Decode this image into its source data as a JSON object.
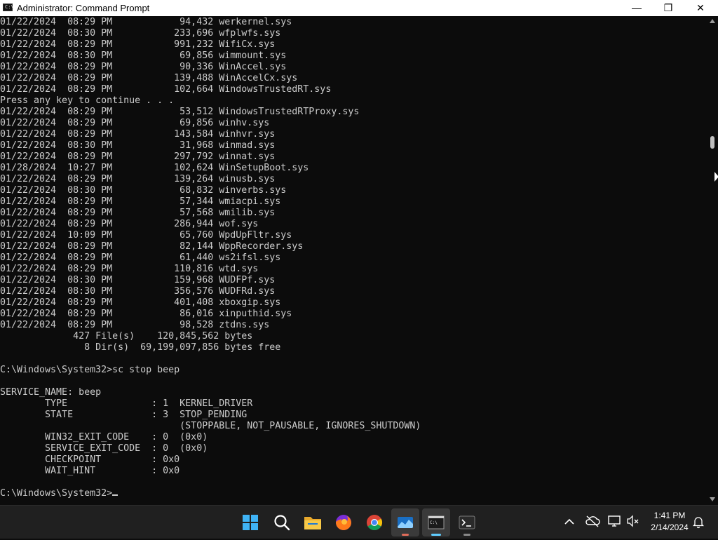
{
  "window": {
    "title": "Administrator: Command Prompt",
    "icon": "cmd-icon",
    "controls": {
      "minimize": "—",
      "maximize": "❐",
      "close": "✕"
    }
  },
  "console": {
    "lines": [
      "01/22/2024  08:29 PM            94,432 werkernel.sys",
      "01/22/2024  08:30 PM           233,696 wfplwfs.sys",
      "01/22/2024  08:29 PM           991,232 WifiCx.sys",
      "01/22/2024  08:30 PM            69,856 wimmount.sys",
      "01/22/2024  08:29 PM            90,336 WinAccel.sys",
      "01/22/2024  08:29 PM           139,488 WinAccelCx.sys",
      "01/22/2024  08:29 PM           102,664 WindowsTrustedRT.sys",
      "Press any key to continue . . .",
      "01/22/2024  08:29 PM            53,512 WindowsTrustedRTProxy.sys",
      "01/22/2024  08:29 PM            69,856 winhv.sys",
      "01/22/2024  08:29 PM           143,584 winhvr.sys",
      "01/22/2024  08:30 PM            31,968 winmad.sys",
      "01/22/2024  08:29 PM           297,792 winnat.sys",
      "01/28/2024  10:27 PM           102,624 WinSetupBoot.sys",
      "01/22/2024  08:29 PM           139,264 winusb.sys",
      "01/22/2024  08:30 PM            68,832 winverbs.sys",
      "01/22/2024  08:29 PM            57,344 wmiacpi.sys",
      "01/22/2024  08:29 PM            57,568 wmilib.sys",
      "01/22/2024  08:29 PM           286,944 wof.sys",
      "01/22/2024  10:09 PM            65,760 WpdUpFltr.sys",
      "01/22/2024  08:29 PM            82,144 WppRecorder.sys",
      "01/22/2024  08:29 PM            61,440 ws2ifsl.sys",
      "01/22/2024  08:29 PM           110,816 wtd.sys",
      "01/22/2024  08:30 PM           159,968 WUDFPf.sys",
      "01/22/2024  08:30 PM           356,576 WUDFRd.sys",
      "01/22/2024  08:29 PM           401,408 xboxgip.sys",
      "01/22/2024  08:29 PM            86,016 xinputhid.sys",
      "01/22/2024  08:29 PM            98,528 ztdns.sys",
      "             427 File(s)    120,845,562 bytes",
      "               8 Dir(s)  69,199,097,856 bytes free",
      "",
      "C:\\Windows\\System32>sc stop beep",
      "",
      "SERVICE_NAME: beep",
      "        TYPE               : 1  KERNEL_DRIVER",
      "        STATE              : 3  STOP_PENDING",
      "                                (STOPPABLE, NOT_PAUSABLE, IGNORES_SHUTDOWN)",
      "        WIN32_EXIT_CODE    : 0  (0x0)",
      "        SERVICE_EXIT_CODE  : 0  (0x0)",
      "        CHECKPOINT         : 0x0",
      "        WAIT_HINT          : 0x0",
      ""
    ],
    "prompt": "C:\\Windows\\System32>",
    "text_color": "#cccccc",
    "background": "#0c0c0c"
  },
  "taskbar": {
    "apps": [
      {
        "name": "start",
        "icon": "windows-logo-icon"
      },
      {
        "name": "search",
        "icon": "search-icon"
      },
      {
        "name": "file-explorer",
        "icon": "folder-icon"
      },
      {
        "name": "firefox",
        "icon": "firefox-icon"
      },
      {
        "name": "chrome",
        "icon": "chrome-icon"
      },
      {
        "name": "photos",
        "icon": "photos-icon"
      },
      {
        "name": "command-prompt",
        "icon": "cmd-icon"
      },
      {
        "name": "terminal",
        "icon": "terminal-icon"
      }
    ],
    "tray_icons": [
      "chevron-up-icon",
      "cloud-offline-icon",
      "network-icon",
      "volume-muted-icon",
      "notification-bell-icon"
    ],
    "time": "1:41 PM",
    "date": "2/14/2024"
  }
}
